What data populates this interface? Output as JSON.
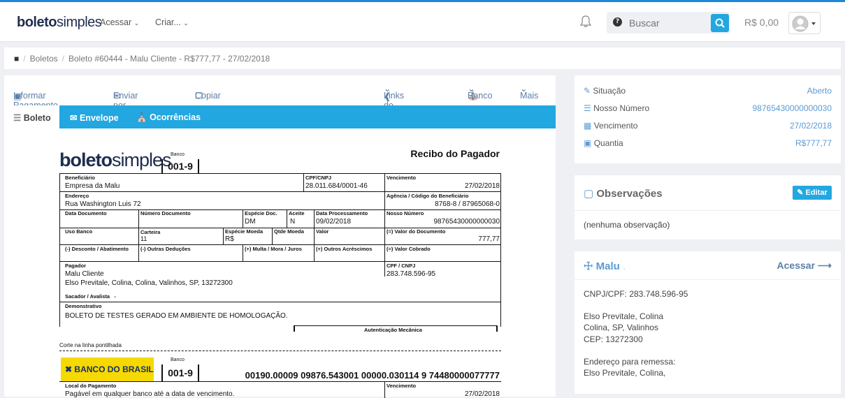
{
  "nav": {
    "logo_bold": "boleto",
    "logo_light": "simples",
    "acessar": "Acessar",
    "criar": "Criar...",
    "search_placeholder": "Buscar",
    "balance": "R$ 0,00"
  },
  "breadcrumb": {
    "home_icon": "home-icon",
    "boletos": "Boletos",
    "current": "Boleto #60444 - Malu Cliente - R$777,77 - 27/02/2018"
  },
  "actions": {
    "informar": "Informar Pagamento",
    "enviar": "Enviar por email",
    "copiar": "Copiar",
    "links": "Links do Boleto",
    "banco": "Banco",
    "mais": "Mais"
  },
  "tabs": {
    "boleto": "Boleto",
    "envelope": "Envelope",
    "ocorrencias": "Ocorrências"
  },
  "boleto": {
    "logo_bold": "boleto",
    "logo_light": "simples",
    "banco_label": "Banco",
    "banco_code": "001-9",
    "recibo_title": "Recibo do Pagador",
    "beneficiario_label": "Beneficiário",
    "beneficiario": "Empresa da Malu",
    "cpfcnpj_label": "CPF/CNPJ",
    "cpfcnpj": "28.011.684/0001-46",
    "vencimento_label": "Vencimento",
    "vencimento": "27/02/2018",
    "endereco_label": "Endereço",
    "endereco": "Rua Washington Luis 72",
    "agencia_label": "Agência / Código do Beneficiário",
    "agencia": "8768-8 / 87965068-0",
    "data_doc_label": "Data Documento",
    "numero_doc_label": "Número Documento",
    "especie_doc_label": "Espécie Doc.",
    "especie_doc": "DM",
    "aceite_label": "Aceite",
    "aceite": "N",
    "data_proc_label": "Data Processamento",
    "data_proc": "09/02/2018",
    "nosso_numero_label": "Nosso Número",
    "nosso_numero": "98765430000000030",
    "uso_banco_label": "Uso Banco",
    "carteira_label": "Carteira",
    "carteira": "11",
    "especie_moeda_label": "Espécie Moeda",
    "especie_moeda": "R$",
    "qtde_moeda_label": "Qtde Moeda",
    "valor_label": "Valor",
    "valor_doc_label": "(=) Valor do Documento",
    "valor_doc": "777,77",
    "desconto_label": "(-) Desconto / Abatimento",
    "outras_ded_label": "(-) Outras Deduções",
    "multa_label": "(+) Multa / Mora / Juros",
    "outros_acr_label": "(+) Outros Acréscimos",
    "valor_cobrado_label": "(=) Valor Cobrado",
    "pagador_label": "Pagador",
    "pagador_nome": "Malu Cliente",
    "pagador_end": "Elso Previtale, Colina, Colina, Valinhos, SP, 13272300",
    "pagador_cpf_label": "CPF / CNPJ",
    "pagador_cpf": "283.748.596-95",
    "sacador_label": "Sacador / Avalista",
    "sacador": "-",
    "demonstrativo_label": "Demonstrativo",
    "demonstrativo": "BOLETO DE TESTES GERADO EM AMBIENTE DE HOMOLOGAÇÃO.",
    "autenticacao_label": "Autenticação Mecânica",
    "corte": "Corte na linha pontilhada",
    "bb_logo": "BANCO DO BRASIL",
    "linha_digitavel": "00190.00009 09876.543001 00000.030114 9 74480000077777",
    "local_pag_label": "Local do Pagamento",
    "local_pag": "Pagável em qualquer banco até a data de vencimento."
  },
  "info": {
    "situacao_label": "Situação",
    "situacao": "Aberto",
    "nosso_numero_label": "Nosso Número",
    "nosso_numero": "98765430000000030",
    "vencimento_label": "Vencimento",
    "vencimento": "27/02/2018",
    "quantia_label": "Quantia",
    "quantia": "R$777,77"
  },
  "obs": {
    "title": "Observações",
    "edit": "Editar",
    "text": "(nenhuma observação)"
  },
  "client": {
    "name": "Malu",
    "dot": ".",
    "acessar": "Acessar",
    "cnpj": "CNPJ/CPF: 283.748.596-95",
    "addr1": "Elso Previtale, Colina",
    "addr2": "Colina, SP, Valinhos",
    "cep": "CEP: 13272300",
    "remessa_label": "Endereço para remessa:",
    "remessa": "Elso Previtale, Colina,"
  },
  "colors": {
    "accent": "#22a7e0",
    "link": "#5b9bd5",
    "brand": "#1f2d4f",
    "bb_yellow": "#f6d900"
  }
}
